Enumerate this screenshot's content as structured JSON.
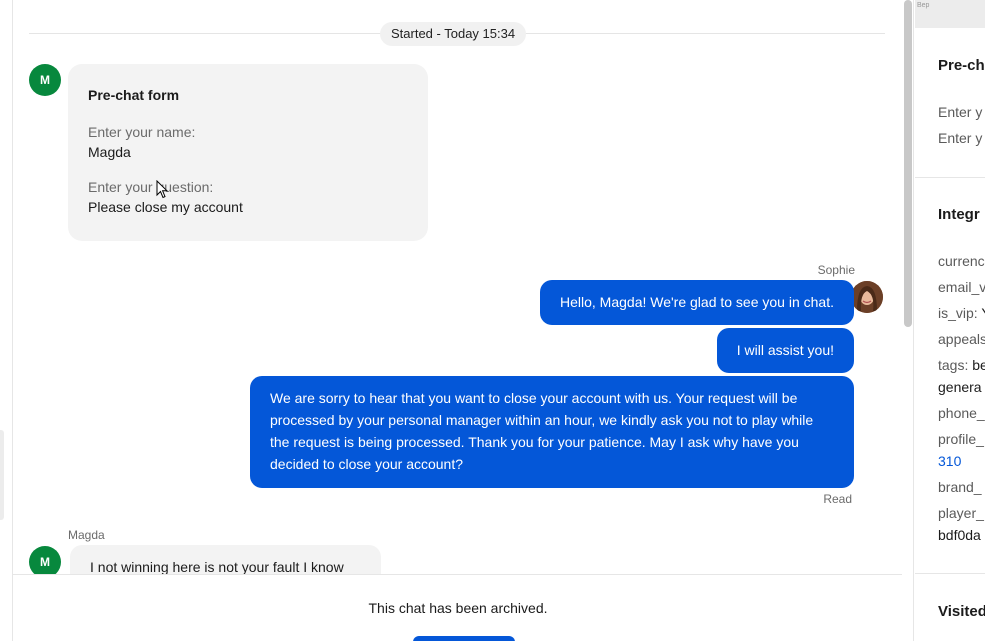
{
  "chat": {
    "started_label": "Started - Today 15:34",
    "visitor_initial": "M",
    "prechat": {
      "title": "Pre-chat form",
      "name_label": "Enter your name:",
      "name_value": "Magda",
      "question_label": "Enter your question:",
      "question_value": "Please close my account"
    },
    "agent_name": "Sophie",
    "messages": [
      {
        "text": "Hello, Magda! We're glad to see you in chat."
      },
      {
        "text": "I will assist you!"
      },
      {
        "text": "We are sorry to hear that you want to close your account with us. Your request will be processed by your personal manager within an hour, we kindly ask you not to play while the request is being processed. Thank you for your patience. May I ask why have you decided to close your account?"
      }
    ],
    "read_status": "Read",
    "visitor_name": "Magda",
    "visitor_message": "I not winning here is not your fault I know",
    "archived_text": "This chat has been archived."
  },
  "side": {
    "map_label": "Bep",
    "prechat_heading": "Pre-ch",
    "prechat_rows": [
      "Enter y",
      "Enter y"
    ],
    "integration_heading": "Integr",
    "rows": [
      {
        "label": "currenc"
      },
      {
        "label": "email_v"
      },
      {
        "label": "is_vip:",
        "value": "Y"
      },
      {
        "label": "appeals"
      },
      {
        "label": "tags:",
        "value": "be"
      },
      {
        "label": "genera"
      },
      {
        "label": "phone_"
      },
      {
        "label": "profile_"
      },
      {
        "label": "310"
      },
      {
        "label": "brand_"
      },
      {
        "label": "player_"
      },
      {
        "label": "bdf0da"
      }
    ],
    "visited_heading": "Visited"
  }
}
